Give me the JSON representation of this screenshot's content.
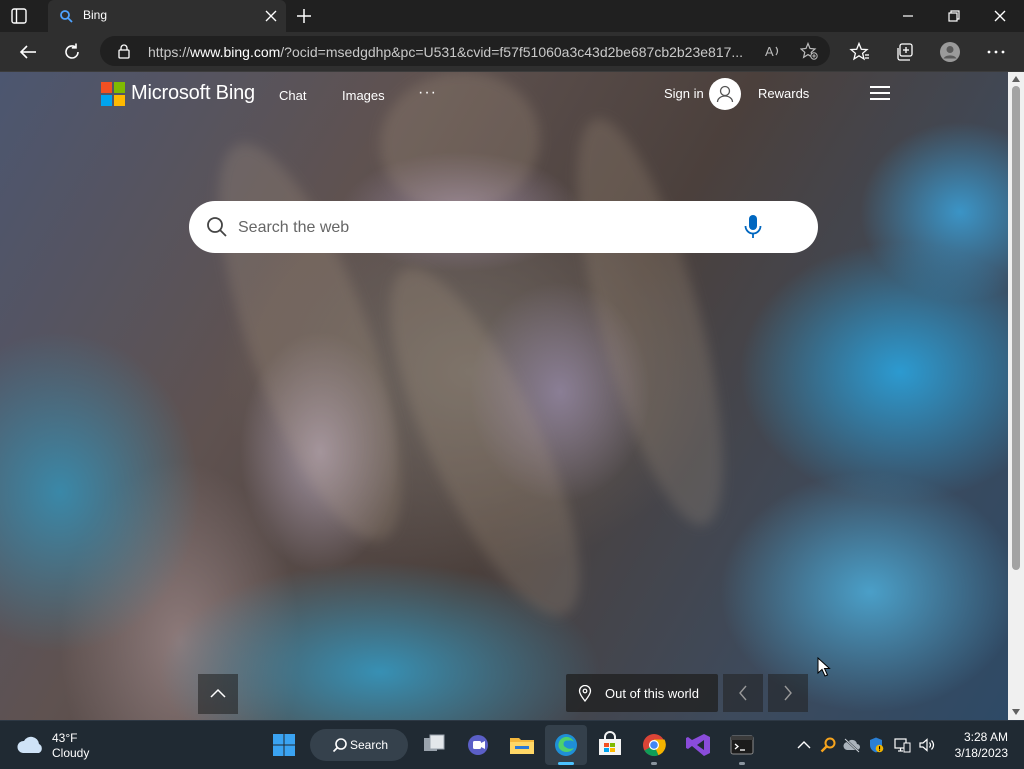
{
  "browser": {
    "tab_title": "Bing",
    "url_prefix": "https://",
    "url_host": "www.bing.com",
    "url_rest": "/?ocid=msedgdhp&pc=U531&cvid=f57f51060a3c43d2be687cb2b23e817..."
  },
  "bing": {
    "brand": "Microsoft Bing",
    "nav": {
      "chat": "Chat",
      "images": "Images",
      "more": "···"
    },
    "sign_in": "Sign in",
    "rewards": "Rewards",
    "search_placeholder": "Search the web",
    "image_caption": "Out of this world"
  },
  "taskbar": {
    "weather_temp": "43°F",
    "weather_condition": "Cloudy",
    "search_label": "Search",
    "time": "3:28 AM",
    "date": "3/18/2023"
  },
  "colors": {
    "taskbar_bg": "#202a33",
    "browser_frame": "#202020",
    "accent_blue": "#0067c0"
  }
}
